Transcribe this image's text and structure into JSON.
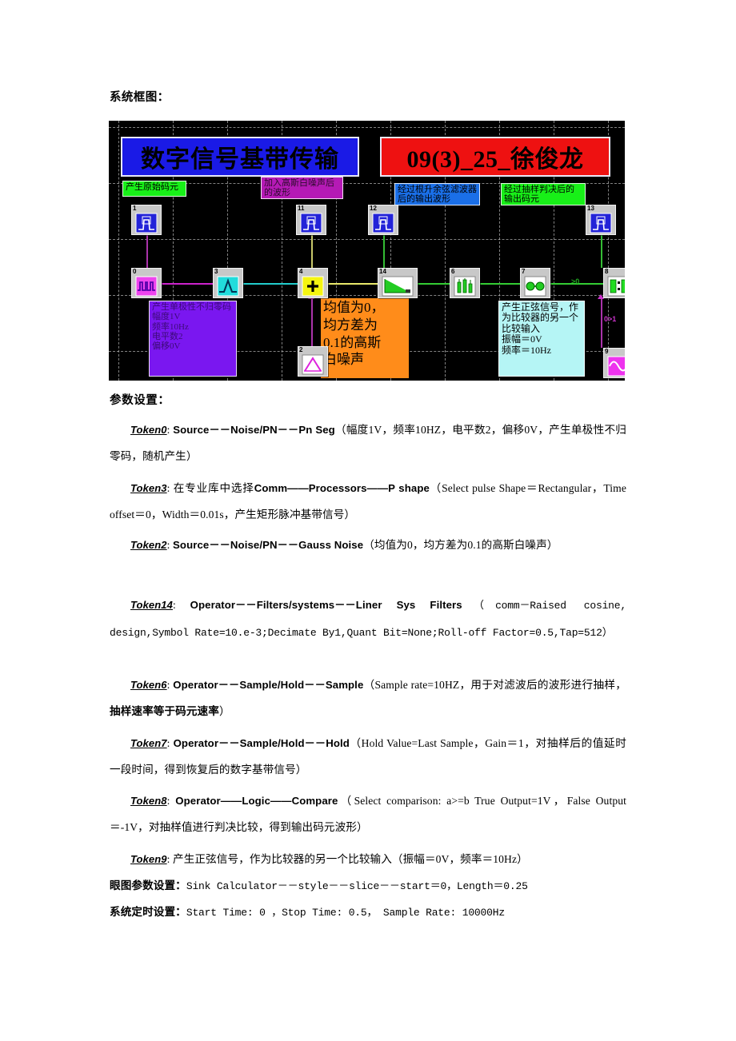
{
  "document": {
    "intro_label": "系统框图：",
    "section_title": "参数设置："
  },
  "diagram": {
    "title_banner": "数字信号基带传输",
    "author_banner": "09(3)_25_徐俊龙",
    "notes": {
      "green_top": "产生原始码元",
      "magenta_top": "加入高斯白噪声后的波形",
      "blue_mid": "经过根升余弦滤波器后的输出波形",
      "green_mid": "经过抽样判决后的输出码元",
      "purple_bottom": "产生单极性不归零码\n幅度1V\n频率10Hz\n电平数2\n偏移0V",
      "orange_bottom": "均值为0，\n均方差为\n0.1的高斯\n白噪声",
      "cyan_bottom": "产生正弦信号，作为比较器的另一个比较输入\n振幅＝0V\n频率＝10Hz"
    },
    "blocks": [
      {
        "id": "0",
        "icon": "pn-sequence-icon"
      },
      {
        "id": "1",
        "icon": "sink-scope-icon"
      },
      {
        "id": "2",
        "icon": "gauss-noise-icon"
      },
      {
        "id": "3",
        "icon": "pulse-shape-icon"
      },
      {
        "id": "4",
        "icon": "adder-icon"
      },
      {
        "id": "6",
        "icon": "sample-icon"
      },
      {
        "id": "7",
        "icon": "hold-icon"
      },
      {
        "id": "8",
        "icon": "compare-icon"
      },
      {
        "id": "9",
        "icon": "sine-source-icon"
      },
      {
        "id": "11",
        "icon": "sink-scope-icon"
      },
      {
        "id": "12",
        "icon": "sink-scope-icon"
      },
      {
        "id": "13",
        "icon": "sink-scope-icon"
      },
      {
        "id": "14",
        "icon": "raised-cosine-filter-icon"
      }
    ],
    "port_labels": {
      "compare_input_a": ">0",
      "compare_input_b": "0>1"
    },
    "colors": {
      "banner_title_bg": "#1a1ae6",
      "banner_author_bg": "#ee1111",
      "note_green": "#18f018",
      "note_magenta": "#b51ab5",
      "note_blue": "#1a6fe8",
      "note_purple": "#7a17f0",
      "note_orange": "#ff8c1a",
      "note_cyan": "#b5f5f5",
      "canvas_bg": "#000000"
    }
  },
  "params": {
    "token0": {
      "token": "Token0",
      "colon": ": ",
      "path": "Source－－Noise/PN－－Pn Seg",
      "detail": "（幅度1V，频率10HZ，电平数2，偏移0V，产生单极性不归零码，随机产生）"
    },
    "token3": {
      "token": "Token3",
      "colon": ": ",
      "prefix_cn": "在专业库中选择",
      "path": "Comm——Processors——P        shape",
      "detail": "（Select            pulse Shape＝Rectangular，Time offset＝0，Width＝0.01s，产生矩形脉冲基带信号）"
    },
    "token2": {
      "token": "Token2",
      "colon": ": ",
      "path": "Source－－Noise/PN－－Gauss Noise",
      "detail": "（均值为0，均方差为0.1的高斯白噪声）"
    },
    "token14": {
      "token": "Token14",
      "colon": ": ",
      "path": "Operator－－Filters/systems－－Liner    Sys    Filters",
      "detail": "（comm－Raised cosine, design,Symbol      Rate=10.e-3;Decimate      By1,Quant      Bit=None;Roll-off Factor=0.5,Tap=512）"
    },
    "token6": {
      "token": "Token6",
      "colon": ": ",
      "path": "Operator－－Sample/Hold－－Sample",
      "detail_a": "（Sample   rate=10HZ，用于对滤波后的波形进行抽样，",
      "detail_bold": "抽样速率等于码元速率",
      "detail_b": "）"
    },
    "token7": {
      "token": "Token7",
      "colon": ": ",
      "path": "Operator－－Sample/Hold－－Hold",
      "detail": "（Hold Value=Last Sample，Gain＝1，对抽样后的值延时一段时间，得到恢复后的数字基带信号）"
    },
    "token8": {
      "token": "Token8",
      "colon": ": ",
      "path": "Operator——Logic——Compare",
      "detail": "（Select          comparison: a>=b        True Output=1V，False Output＝-1V，对抽样值进行判决比较，得到输出码元波形）"
    },
    "token9": {
      "token": "Token9",
      "colon": ": ",
      "detail": "产生正弦信号，作为比较器的另一个比较输入（振幅＝0V，频率＝10Hz）"
    },
    "eye_diagram": {
      "label": "眼图参数设置：",
      "value": "Sink Calculator－－style－－slice－－start＝0，Length＝0.25"
    },
    "system_timing": {
      "label": "系统定时设置：",
      "value": "Start Time: 0 ，Stop Time: 0.5，  Sample Rate: 10000Hz"
    }
  }
}
